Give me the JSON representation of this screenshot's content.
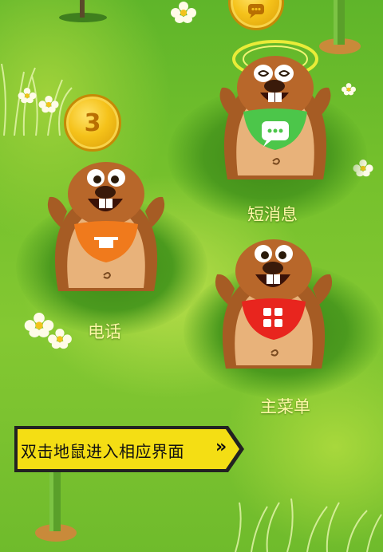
{
  "screen": {
    "title": ""
  },
  "moles": [
    {
      "label": "短消息",
      "bib_color": "#4cc64a",
      "icon": "chat-bubble-icon",
      "dizzy": true
    },
    {
      "label": "电话",
      "bib_color": "#f07a1c",
      "icon": "phone-icon",
      "badge": "3"
    },
    {
      "label": "主菜单",
      "bib_color": "#e8251e",
      "icon": "grid-menu-icon"
    }
  ],
  "hint_banner": {
    "text": "双击地鼠进入相应界面"
  },
  "colors": {
    "accent_yellow": "#f4de14",
    "label_text": "#fff8a8",
    "grass": "#74c02c"
  }
}
